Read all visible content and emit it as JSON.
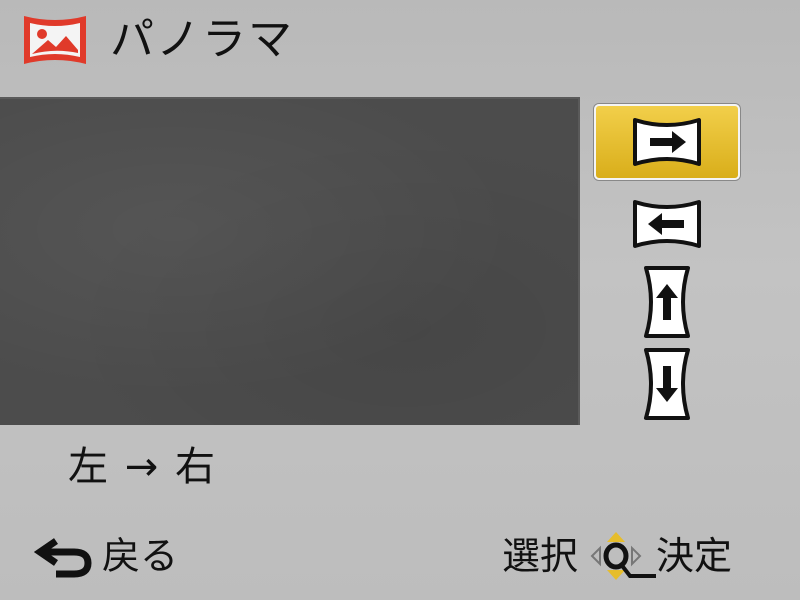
{
  "header": {
    "title": "パノラマ",
    "mode_icon": "panorama-mode-icon",
    "mode_icon_color": "#e03a2a"
  },
  "preview": {
    "background": "#4c4c4c"
  },
  "direction_options": [
    {
      "name": "left-to-right",
      "icon": "arrow-right-icon",
      "selected": true
    },
    {
      "name": "right-to-left",
      "icon": "arrow-left-icon",
      "selected": false
    },
    {
      "name": "bottom-to-top",
      "icon": "arrow-up-icon",
      "selected": false
    },
    {
      "name": "top-to-bottom",
      "icon": "arrow-down-icon",
      "selected": false
    }
  ],
  "selected_highlight_color": "#e6bd2c",
  "direction_label": "左 → 右",
  "footer": {
    "back_label": "戻る",
    "back_icon": "return-arrow-icon",
    "select_label": "選択",
    "dial_icon": "control-dial-icon",
    "dial_accent_color": "#e6bd2c",
    "confirm_label": "決定"
  }
}
